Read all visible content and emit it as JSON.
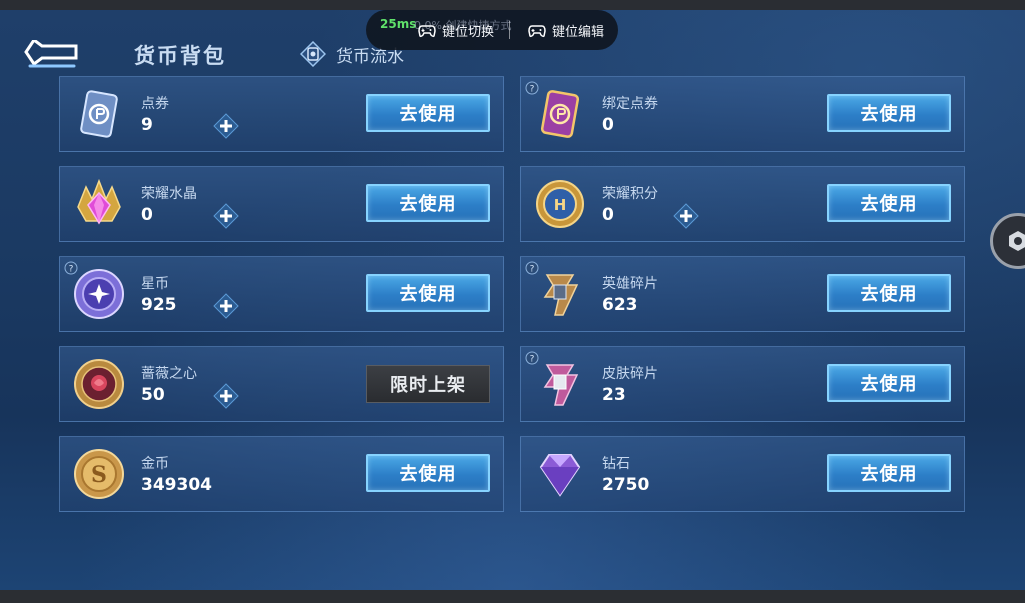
{
  "header": {
    "title": "货币背包",
    "flow_tab": "货币流水"
  },
  "overlay": {
    "ping": "25ms",
    "ghost_text": "0.0% 创建快捷方式",
    "key_switch": "键位切换",
    "key_edit": "键位编辑"
  },
  "currencies": [
    {
      "name": "点券",
      "amount": "9",
      "button": "去使用"
    },
    {
      "name": "绑定点券",
      "amount": "0",
      "button": "去使用"
    },
    {
      "name": "荣耀水晶",
      "amount": "0",
      "button": "去使用"
    },
    {
      "name": "荣耀积分",
      "amount": "0",
      "button": "去使用"
    },
    {
      "name": "星币",
      "amount": "925",
      "button": "去使用"
    },
    {
      "name": "英雄碎片",
      "amount": "623",
      "button": "去使用"
    },
    {
      "name": "蔷薇之心",
      "amount": "50",
      "button": "限时上架"
    },
    {
      "name": "皮肤碎片",
      "amount": "23",
      "button": "去使用"
    },
    {
      "name": "金币",
      "amount": "349304",
      "button": "去使用"
    },
    {
      "name": "钻石",
      "amount": "2750",
      "button": "去使用"
    }
  ],
  "icons": {
    "back": "back-arrow-icon",
    "flow": "currency-flow-icon",
    "gamepad": "gamepad-icon",
    "plus": "plus-icon",
    "help": "help-icon"
  },
  "colors": {
    "accent_button": "#2d7fc8",
    "button_border": "#86d3ff",
    "ping_green": "#5fe06a"
  }
}
